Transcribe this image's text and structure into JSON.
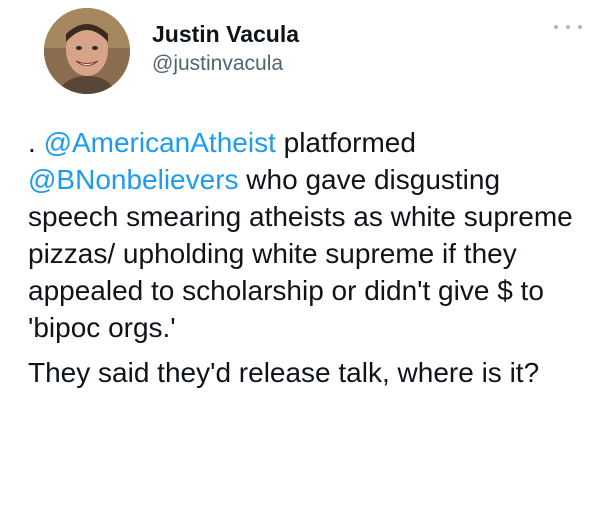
{
  "tweet": {
    "author": {
      "name": "Justin Vacula",
      "handle": "@justinvacula"
    },
    "paragraph1": {
      "prefix": ". ",
      "mention1": "@AmericanAtheist",
      "text1": " platformed ",
      "mention2": "@BNonbelievers",
      "text2": " who gave disgusting speech smearing atheists as white supreme pizzas/ upholding white supreme if they appealed to scholarship or didn't give $ to 'bipoc orgs.'"
    },
    "paragraph2": "They said they'd release talk, where is it?",
    "more_icon": "more-horizontal-icon",
    "colors": {
      "link": "#1d9bf0",
      "secondary_text": "#536471",
      "text": "#0f1419"
    }
  }
}
